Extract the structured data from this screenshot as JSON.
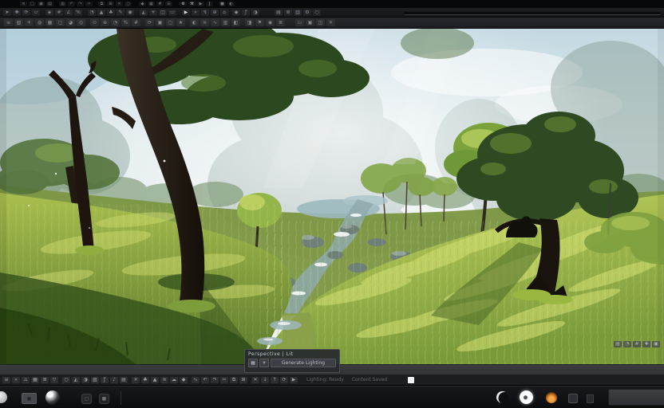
{
  "palette": {
    "toolbar_bg": "#1b1e21",
    "taskbar_bg": "#101214",
    "panel_bg": "#2a2e32",
    "sky": "#e4edef",
    "haze": "#8fa7a0",
    "grass_bright": "#c2d35f",
    "grass_shadow": "#314d17",
    "canopy": "#2c481f",
    "trunk": "#241c13",
    "water": "#9bb9bf",
    "flame_accent": "#cf7a24"
  },
  "status_panel": {
    "title": "Perspective | Lit",
    "button_a": "▦",
    "button_b": "☀",
    "action_label": "Generate Lighting"
  },
  "dock": {
    "status1": "Lighting: Ready",
    "status2": "Content Saved"
  },
  "strips": {
    "menubar": [
      {
        "n": "app-menu-icon",
        "g": "≡"
      },
      {
        "n": "new-file-icon",
        "g": "▢"
      },
      {
        "n": "open-file-icon",
        "g": "▣"
      },
      {
        "n": "save-icon",
        "g": "▤"
      },
      {
        "n": "save-all-icon",
        "g": "▥",
        "ml": 6
      },
      {
        "n": "undo-icon",
        "g": "↶"
      },
      {
        "n": "redo-icon",
        "g": "↷"
      },
      {
        "n": "cut-icon",
        "g": "✂"
      },
      {
        "n": "copy-icon",
        "g": "⧉",
        "ml": 6
      },
      {
        "n": "paste-icon",
        "g": "⊞"
      },
      {
        "n": "delete-icon",
        "g": "✕"
      },
      {
        "n": "find-icon",
        "g": "○"
      },
      {
        "n": "select-all-icon",
        "g": "◆",
        "ml": 8
      },
      {
        "n": "grid-icon",
        "g": "▦"
      },
      {
        "n": "snap-icon",
        "g": "#"
      },
      {
        "n": "layers-icon",
        "g": "☰"
      },
      {
        "n": "settings-icon",
        "g": "⚙",
        "ml": 8,
        "c": "#c8ccd0"
      },
      {
        "n": "build-icon",
        "g": "⚒",
        "c": "#c8ccd0"
      },
      {
        "n": "play-icon",
        "g": "▶"
      },
      {
        "n": "pause-icon",
        "g": "‖"
      },
      {
        "n": "stop-icon",
        "g": "■",
        "ml": 6
      },
      {
        "n": "shading-icon",
        "g": "◐"
      }
    ],
    "toolbar2": [
      {
        "n": "select-tool-icon",
        "g": "➤"
      },
      {
        "n": "move-tool-icon",
        "g": "✚"
      },
      {
        "n": "rotate-tool-icon",
        "g": "⟳"
      },
      {
        "n": "scale-tool-icon",
        "g": "▱"
      },
      {
        "n": "pivot-icon",
        "g": "◈",
        "ml": 6
      },
      {
        "n": "snap-grid-icon",
        "g": "#"
      },
      {
        "n": "snap-angle-icon",
        "g": "∠"
      },
      {
        "n": "snap-scale-icon",
        "g": "%"
      },
      {
        "n": "camera-speed-icon",
        "g": "◔",
        "ml": 6
      },
      {
        "n": "terrain-tool-icon",
        "g": "▲"
      },
      {
        "n": "foliage-tool-icon",
        "g": "♣"
      },
      {
        "n": "brush-tool-icon",
        "g": "✎"
      },
      {
        "n": "paint-tool-icon",
        "g": "◉"
      },
      {
        "n": "mesh-tool-icon",
        "g": "◭",
        "ml": 6
      },
      {
        "n": "light-tool-icon",
        "g": "☀"
      },
      {
        "n": "volume-tool-icon",
        "g": "◫"
      },
      {
        "n": "cinematic-tool-icon",
        "g": "▭"
      },
      {
        "n": "play-viewport-icon",
        "g": "▶",
        "ml": 6,
        "c": "#d6d9db"
      },
      {
        "n": "launch-icon",
        "g": "»"
      },
      {
        "n": "build-lighting-icon",
        "g": "↯"
      },
      {
        "n": "source-control-icon",
        "g": "⊕"
      },
      {
        "n": "content-browser-icon",
        "g": "⌂"
      },
      {
        "n": "marketplace-icon",
        "g": "◆",
        "ml": 4
      },
      {
        "n": "blueprint-icon",
        "g": "ƒ"
      },
      {
        "n": "material-editor-icon",
        "g": "◑"
      },
      {
        "n": "stats-panel-icon",
        "g": "▤",
        "ml": 18
      },
      {
        "n": "outliner-icon",
        "g": "≣"
      },
      {
        "n": "details-icon",
        "g": "▥"
      },
      {
        "n": "world-settings-icon",
        "g": "⚙"
      },
      {
        "n": "search-icon",
        "g": "○"
      }
    ],
    "toolbar3": [
      {
        "n": "viewport-menu-icon",
        "g": "≡"
      },
      {
        "n": "perspective-mode-icon",
        "g": "▧"
      },
      {
        "n": "lit-mode-icon",
        "g": "☀"
      },
      {
        "n": "show-flags-icon",
        "g": "◍"
      },
      {
        "n": "wireframe-icon",
        "g": "▦"
      },
      {
        "n": "unlit-icon",
        "g": "◻"
      },
      {
        "n": "detail-lighting-icon",
        "g": "◕"
      },
      {
        "n": "reflections-icon",
        "g": "◎"
      },
      {
        "n": "exposure-icon",
        "g": "⊙",
        "ml": 5
      },
      {
        "n": "focus-icon",
        "g": "⊕"
      },
      {
        "n": "fov-icon",
        "g": "◔"
      },
      {
        "n": "screen-percentage-icon",
        "g": "%"
      },
      {
        "n": "grid-snap-icon",
        "g": "#"
      },
      {
        "n": "realtime-icon",
        "g": "⟳",
        "ml": 5
      },
      {
        "n": "game-view-icon",
        "g": "▣"
      },
      {
        "n": "immersive-icon",
        "g": "▢"
      },
      {
        "n": "bookmark-icon",
        "g": "★"
      },
      {
        "n": "shadows-icon",
        "g": "◐",
        "ml": 5
      },
      {
        "n": "water-icon",
        "g": "≋"
      },
      {
        "n": "wind-icon",
        "g": "∿"
      },
      {
        "n": "layers-panel-icon",
        "g": "▥"
      },
      {
        "n": "split-horizontal-icon",
        "g": "◧"
      },
      {
        "n": "split-vertical-icon",
        "g": "◨",
        "ml": 5
      },
      {
        "n": "flag-icon",
        "g": "⚑"
      },
      {
        "n": "snapshot-icon",
        "g": "◉"
      },
      {
        "n": "stats-icon",
        "g": "≣"
      },
      {
        "n": "minimize-icon",
        "g": "▭",
        "ml": 12
      },
      {
        "n": "restore-icon",
        "g": "▣"
      },
      {
        "n": "dock-panels-icon",
        "g": "◫"
      },
      {
        "n": "close-icon",
        "g": "✕"
      }
    ],
    "dock": [
      {
        "n": "output-log-icon",
        "g": "≡"
      },
      {
        "n": "console-icon",
        "g": "»"
      },
      {
        "n": "content-browser-icon",
        "g": "⌂"
      },
      {
        "n": "asset-grid-icon",
        "g": "▦"
      },
      {
        "n": "asset-list-icon",
        "g": "≣"
      },
      {
        "n": "filter-icon",
        "g": "▽"
      },
      {
        "n": "search-assets-icon",
        "g": "○",
        "ml": 4
      },
      {
        "n": "mesh-asset-icon",
        "g": "◭"
      },
      {
        "n": "material-asset-icon",
        "g": "◑"
      },
      {
        "n": "texture-asset-icon",
        "g": "▨"
      },
      {
        "n": "blueprint-asset-icon",
        "g": "ƒ"
      },
      {
        "n": "audio-asset-icon",
        "g": "♪"
      },
      {
        "n": "level-asset-icon",
        "g": "▤"
      },
      {
        "n": "light-asset-icon",
        "g": "☀",
        "ml": 4
      },
      {
        "n": "foliage-asset-icon",
        "g": "♣"
      },
      {
        "n": "terrain-asset-icon",
        "g": "▲"
      },
      {
        "n": "water-asset-icon",
        "g": "≋"
      },
      {
        "n": "sky-asset-icon",
        "g": "☁"
      },
      {
        "n": "fx-asset-icon",
        "g": "◆"
      },
      {
        "n": "anim-asset-icon",
        "g": "∿",
        "ml": 4
      },
      {
        "n": "undo-history-icon",
        "g": "↶"
      },
      {
        "n": "redo-history-icon",
        "g": "↷"
      },
      {
        "n": "cut-asset-icon",
        "g": "✂"
      },
      {
        "n": "copy-asset-icon",
        "g": "⧉"
      },
      {
        "n": "paste-asset-icon",
        "g": "⊞"
      },
      {
        "n": "delete-asset-icon",
        "g": "✕",
        "ml": 4
      },
      {
        "n": "import-icon",
        "g": "↓"
      },
      {
        "n": "export-icon",
        "g": "↑"
      },
      {
        "n": "sync-icon",
        "g": "⟳"
      },
      {
        "n": "play-preview-icon",
        "g": "▶"
      }
    ],
    "overlay": [
      {
        "n": "overlay-stats-icon",
        "g": "▤"
      },
      {
        "n": "overlay-fps-icon",
        "g": "◔"
      },
      {
        "n": "overlay-grid-icon",
        "g": "#"
      },
      {
        "n": "overlay-axes-icon",
        "g": "✚"
      },
      {
        "n": "overlay-expand-icon",
        "g": "▣"
      }
    ]
  }
}
